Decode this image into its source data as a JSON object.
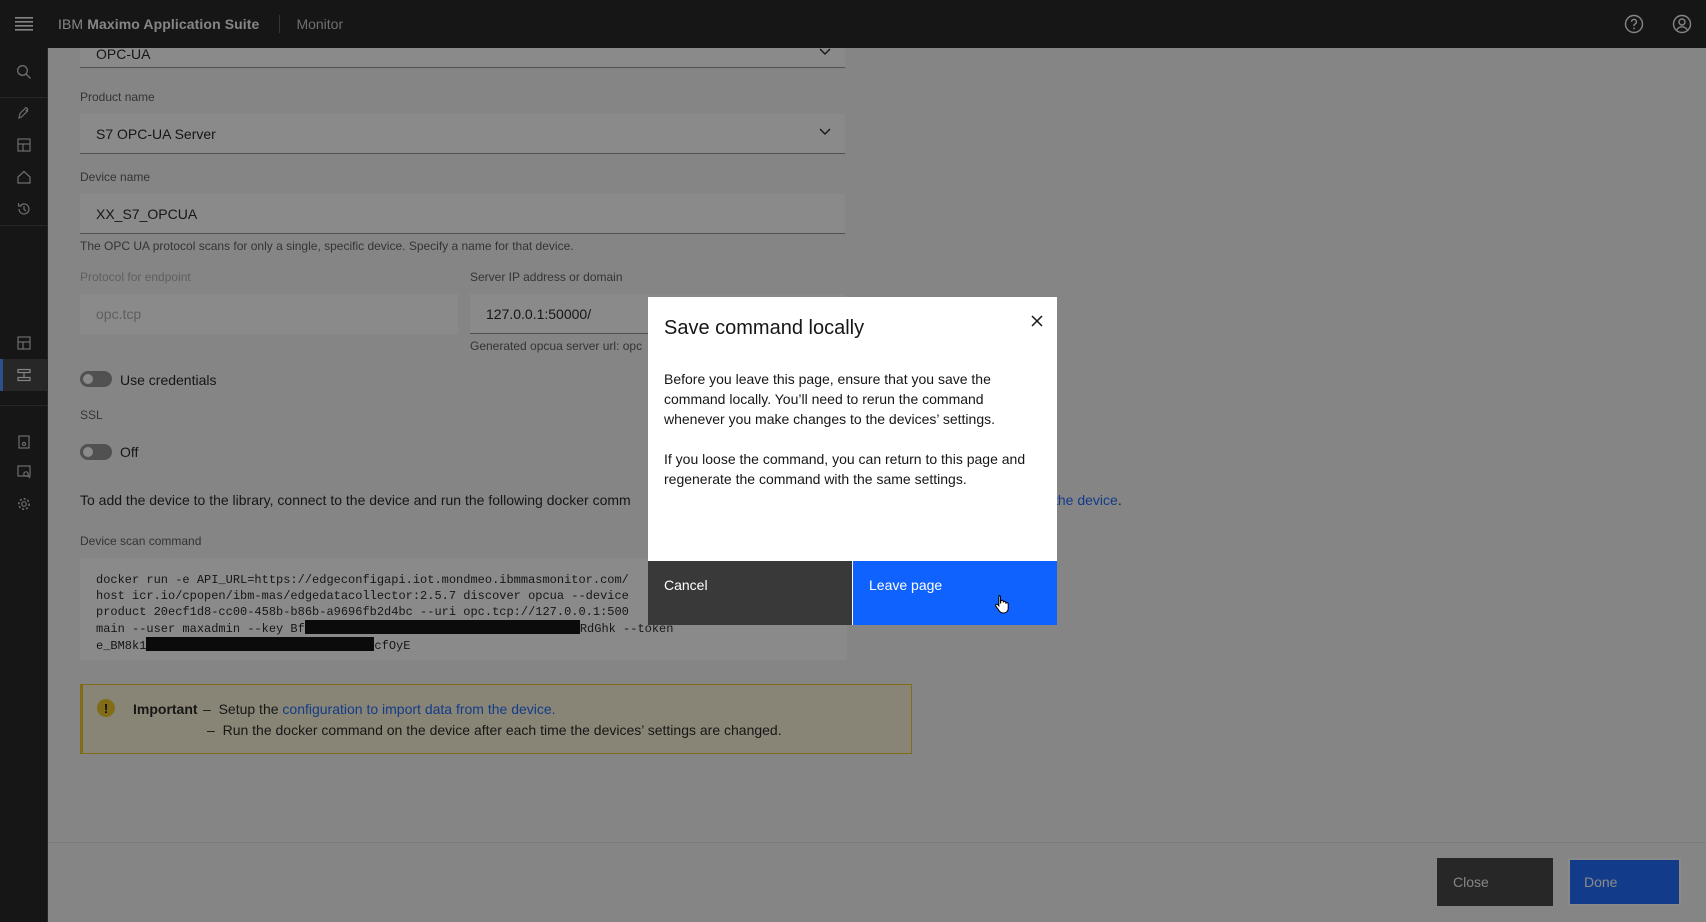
{
  "header": {
    "brand_prefix": "IBM",
    "brand_name": "Maximo Application Suite",
    "app_name": "Monitor",
    "menu_icon": "hamburger-menu-icon",
    "help_icon": "help-icon",
    "user_icon": "user-avatar-icon"
  },
  "form": {
    "protocol_value": "OPC-UA",
    "product_label": "Product name",
    "product_value": "S7 OPC-UA Server",
    "device_label": "Device name",
    "device_value": "XX_S7_OPCUA",
    "device_helper": "The OPC UA protocol scans for only a single, specific device. Specify a name for that device.",
    "endpoint_label": "Protocol for endpoint",
    "endpoint_value": "opc.tcp",
    "server_label": "Server IP address or domain",
    "server_value": "127.0.0.1:50000/",
    "server_helper": "Generated opcua server url: opc",
    "credentials_label": "Use credentials",
    "ssl_label": "SSL",
    "ssl_toggle_label": "Off",
    "instructions_text": "To add the device to the library, connect to the device and run the following docker comm",
    "instructions_link": "the device",
    "scan_label": "Device scan command",
    "cmd_line1": "docker run -e API_URL=https://edgeconfigapi.iot.mondmeo.ibmmasmonitor.com/",
    "cmd_line2": "host icr.io/cpopen/ibm-mas/edgedatacollector:2.5.7 discover opcua --device",
    "cmd_line3": "product 20ecf1d8-cc00-458b-b86b-a9696fb2d4bc --uri opc.tcp://127.0.0.1:500",
    "cmd_line4a": "main --user maxadmin --key Bf",
    "cmd_line4b": "RdGhk --token",
    "cmd_line5a": "e_BM8k1",
    "cmd_line5b": "cfOyE"
  },
  "notice": {
    "title": "Important",
    "dash1": "–",
    "line1_prefix": "Setup the",
    "line1_link": "configuration to import data from the device.",
    "dash2": "–",
    "line2": "Run the docker command on the device after each time the devices’ settings are changed."
  },
  "footer": {
    "close_label": "Close",
    "done_label": "Done"
  },
  "modal": {
    "title": "Save command locally",
    "paragraph1": "Before you leave this page, ensure that you save the command locally. You’ll need to rerun the command whenever you make changes to the devices’ settings.",
    "paragraph2": "If you loose the command, you can return to this page and regenerate the command with the same settings.",
    "cancel_label": "Cancel",
    "leave_label": "Leave page"
  },
  "colors": {
    "accent": "#0f62fe",
    "header_bg": "#161616",
    "warning": "#f1c21b"
  }
}
